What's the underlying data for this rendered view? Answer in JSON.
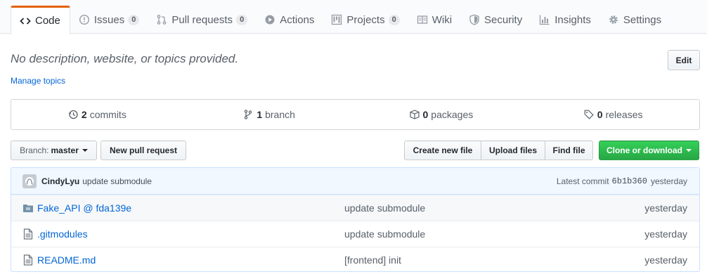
{
  "tabs": [
    {
      "label": "Code",
      "icon": "code-icon"
    },
    {
      "label": "Issues",
      "icon": "issue-icon",
      "count": "0"
    },
    {
      "label": "Pull requests",
      "icon": "pull-request-icon",
      "count": "0"
    },
    {
      "label": "Actions",
      "icon": "play-icon"
    },
    {
      "label": "Projects",
      "icon": "project-icon",
      "count": "0"
    },
    {
      "label": "Wiki",
      "icon": "book-icon"
    },
    {
      "label": "Security",
      "icon": "shield-icon"
    },
    {
      "label": "Insights",
      "icon": "graph-icon"
    },
    {
      "label": "Settings",
      "icon": "gear-icon"
    }
  ],
  "repo": {
    "description": "No description, website, or topics provided.",
    "edit_label": "Edit",
    "manage_topics": "Manage topics"
  },
  "summary": {
    "commits": {
      "num": "2",
      "label": "commits"
    },
    "branches": {
      "num": "1",
      "label": "branch"
    },
    "packages": {
      "num": "0",
      "label": "packages"
    },
    "releases": {
      "num": "0",
      "label": "releases"
    }
  },
  "toolbar": {
    "branch_prefix": "Branch:",
    "branch_name": "master",
    "new_pr": "New pull request",
    "create_file": "Create new file",
    "upload_files": "Upload files",
    "find_file": "Find file",
    "clone": "Clone or download"
  },
  "latest_commit": {
    "author": "CindyLyu",
    "message": "update submodule",
    "label": "Latest commit",
    "sha": "6b1b360",
    "age": "yesterday"
  },
  "files": [
    {
      "name": "Fake_API @ fda139e",
      "icon": "submodule-icon",
      "message": "update submodule",
      "age": "yesterday"
    },
    {
      "name": ".gitmodules",
      "icon": "file-icon",
      "message": "update submodule",
      "age": "yesterday"
    },
    {
      "name": "README.md",
      "icon": "file-icon",
      "message": "[frontend] init",
      "age": "yesterday"
    }
  ],
  "colors": {
    "selected_tab_accent": "#e36209",
    "link": "#0366d6",
    "clone_button": "#28a745",
    "commit_tease_bg": "#f1f8ff"
  }
}
